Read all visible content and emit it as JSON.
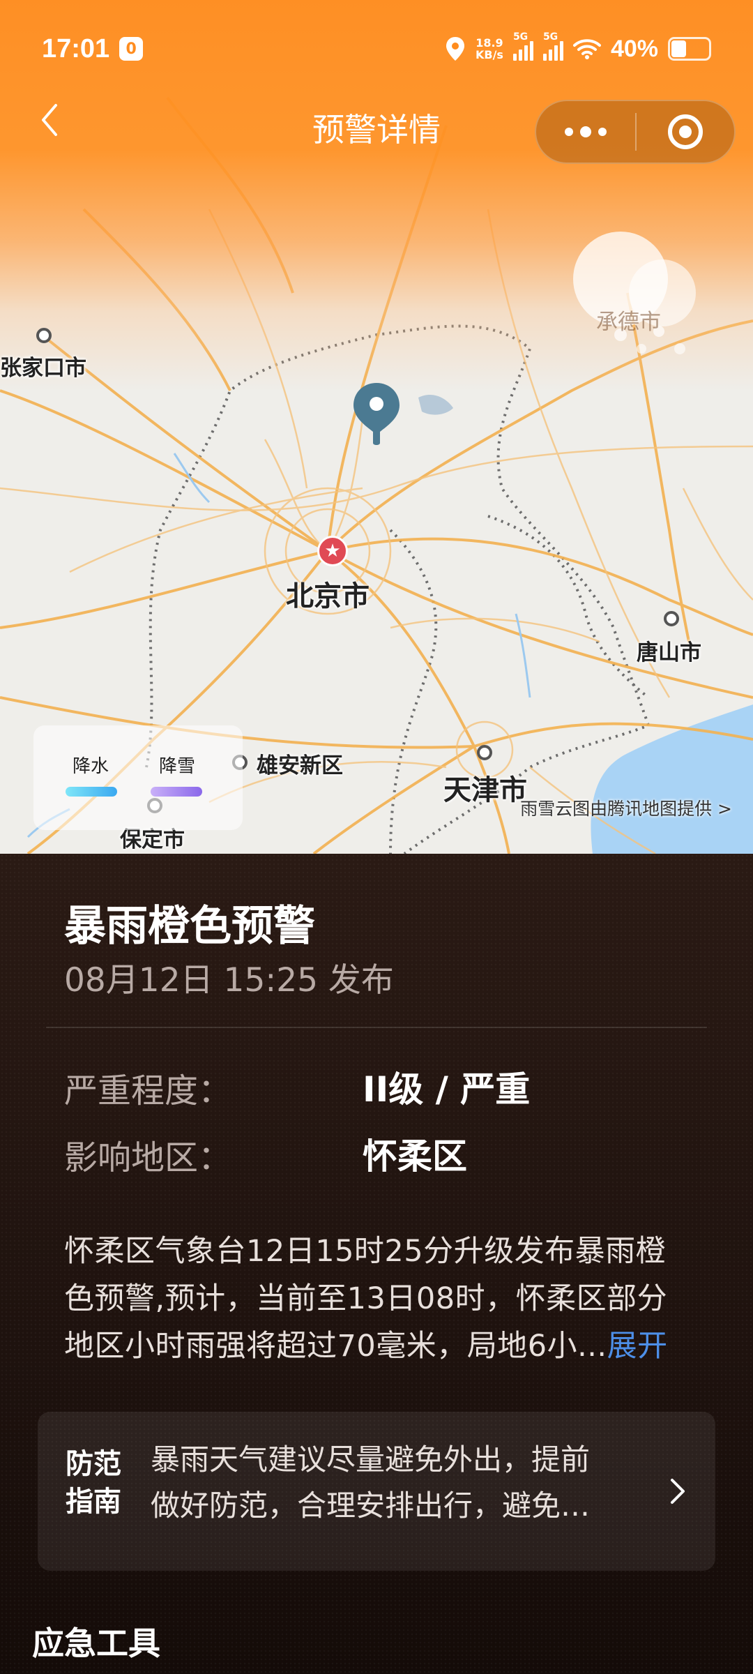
{
  "status_bar": {
    "time": "17:01",
    "vpn_glyph": "0",
    "net_speed_value": "18.9",
    "net_speed_unit": "KB/s",
    "sim1_label": "5G",
    "sim2_label": "5G",
    "battery_pct": "40%",
    "battery_level": 0.4,
    "icons": [
      "location-icon",
      "signal-icon",
      "wifi-icon",
      "battery-icon"
    ]
  },
  "nav": {
    "title": "预警详情"
  },
  "map": {
    "labels": {
      "zhangjiakou": "张家口市",
      "chengde": "承德市",
      "beijing": "北京市",
      "tangshan": "唐山市",
      "xiongan": "雄安新区",
      "tianjin": "天津市",
      "baoding": "保定市"
    },
    "legend": {
      "rain": "降水",
      "snow": "降雪",
      "rain_color": "#56c8f5",
      "snow_color": "#a98cf0"
    },
    "attribution": "雨雪云图由腾讯地图提供 >"
  },
  "alert": {
    "title": "暴雨橙色预警",
    "published": "08月12日 15:25 发布",
    "severity_label": "严重程度：",
    "severity_value": "II级 / 严重",
    "area_label": "影响地区：",
    "area_value": "怀柔区",
    "description_lines": [
      "怀柔区气象台12日15时25分升级发布暴雨橙",
      "色预警,预计，当前至13日08时，怀柔区部分",
      "地区小时雨强将超过70毫米，局地6小..."
    ],
    "expand_label": "展开",
    "accent_color": "#ff8c1e"
  },
  "guide": {
    "tag_line1": "防范",
    "tag_line2": "指南",
    "text_line1": "暴雨天气建议尽量避免外出，提前",
    "text_line2": "做好防范，合理安排出行，避免…"
  },
  "tools": {
    "title": "应急工具"
  }
}
